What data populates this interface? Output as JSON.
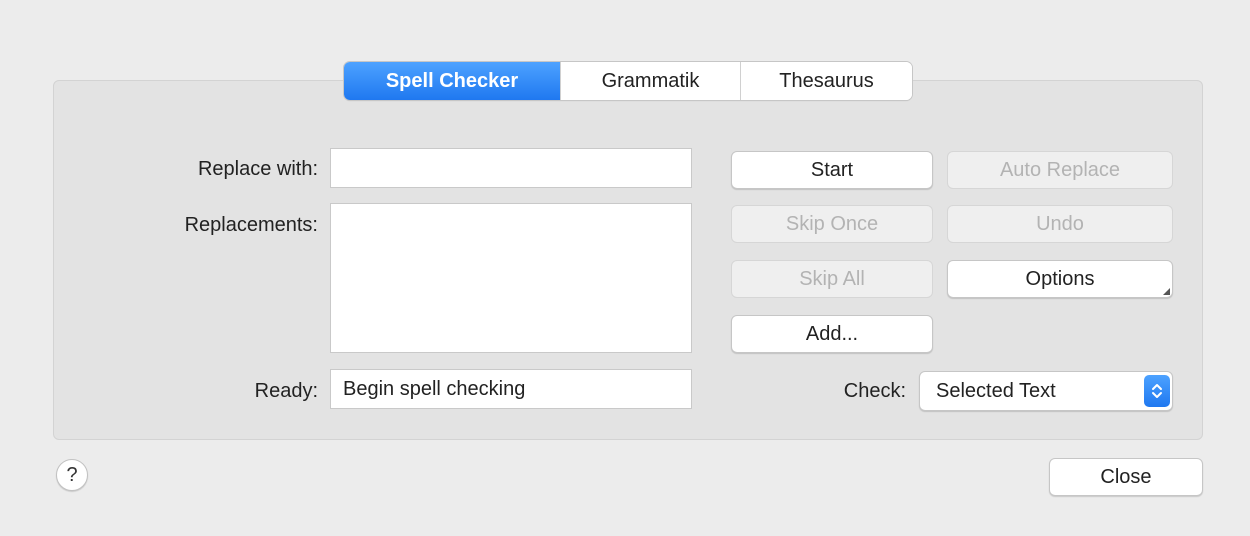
{
  "tabs": [
    {
      "label": "Spell Checker",
      "active": true
    },
    {
      "label": "Grammatik",
      "active": false
    },
    {
      "label": "Thesaurus",
      "active": false
    }
  ],
  "form": {
    "replace_with_label": "Replace with:",
    "replace_with_value": "",
    "replacements_label": "Replacements:",
    "ready_label": "Ready:",
    "ready_value": "Begin spell checking",
    "check_label": "Check:",
    "check_value": "Selected Text"
  },
  "buttons": {
    "start": "Start",
    "auto_replace": "Auto Replace",
    "skip_once": "Skip Once",
    "undo": "Undo",
    "skip_all": "Skip All",
    "options": "Options",
    "add": "Add...",
    "close": "Close",
    "help": "?"
  },
  "colors": {
    "accent": "#1f78f0",
    "window_bg": "#ececec",
    "panel_bg": "#e3e3e3",
    "disabled_text": "#b3b3b3"
  },
  "icons": {
    "help": "question-mark-icon",
    "select_arrows": "up-down-chevron-icon"
  }
}
